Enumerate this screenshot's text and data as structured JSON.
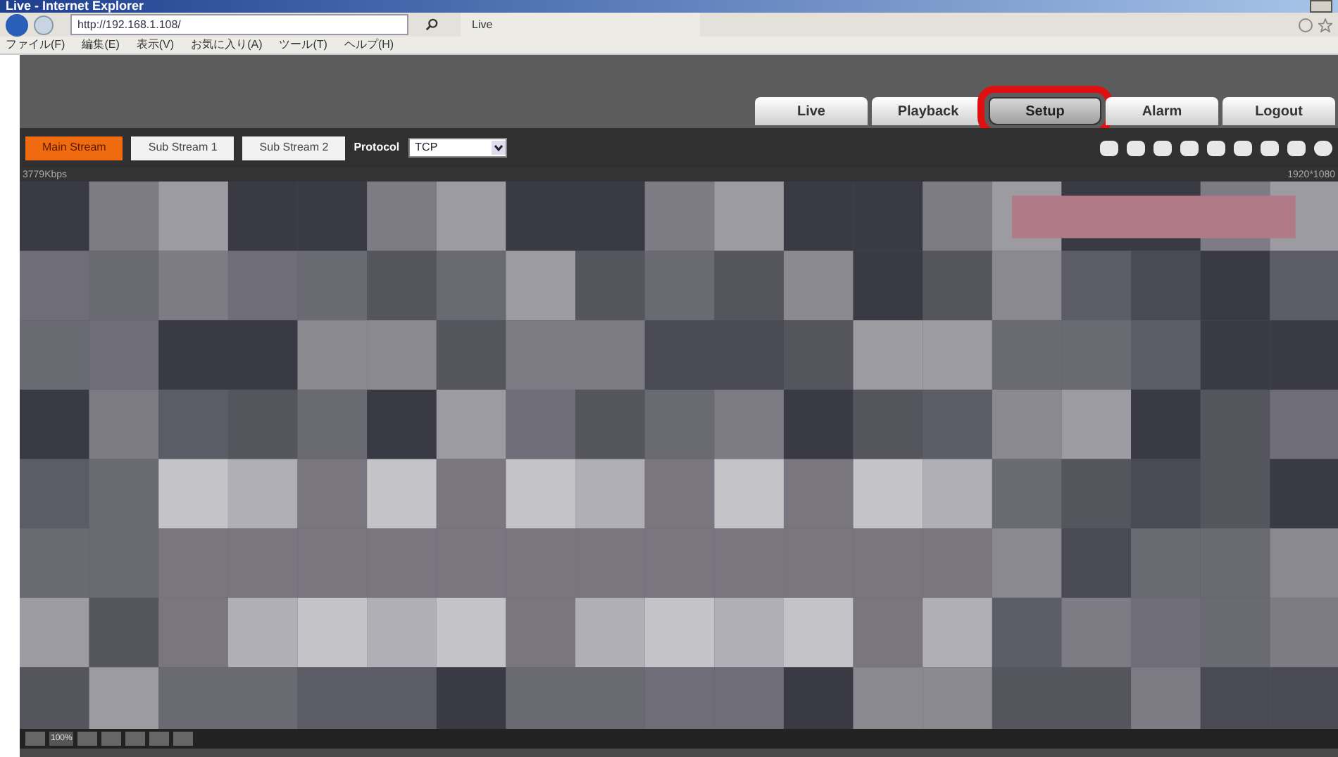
{
  "window": {
    "title": "Live - Internet Explorer"
  },
  "address_bar": {
    "url": "http://192.168.1.108/"
  },
  "browser_tab": {
    "title": "Live"
  },
  "menu": [
    "ファイル(F)",
    "編集(E)",
    "表示(V)",
    "お気に入り(A)",
    "ツール(T)",
    "ヘルプ(H)"
  ],
  "nav_tabs": [
    {
      "label": "Live",
      "selected": false,
      "highlighted": false
    },
    {
      "label": "Playback",
      "selected": false,
      "highlighted": false
    },
    {
      "label": "Setup",
      "selected": true,
      "highlighted": true
    },
    {
      "label": "Alarm",
      "selected": false,
      "highlighted": false
    },
    {
      "label": "Logout",
      "selected": false,
      "highlighted": false
    }
  ],
  "streams": [
    {
      "label": "Main Stream",
      "selected": true
    },
    {
      "label": "Sub Stream 1",
      "selected": false
    },
    {
      "label": "Sub Stream 2",
      "selected": false
    }
  ],
  "protocol": {
    "label": "Protocol",
    "value": "TCP"
  },
  "bitrate": "3779Kbps",
  "resolution": "1920*1080",
  "zoom_label": "100%"
}
